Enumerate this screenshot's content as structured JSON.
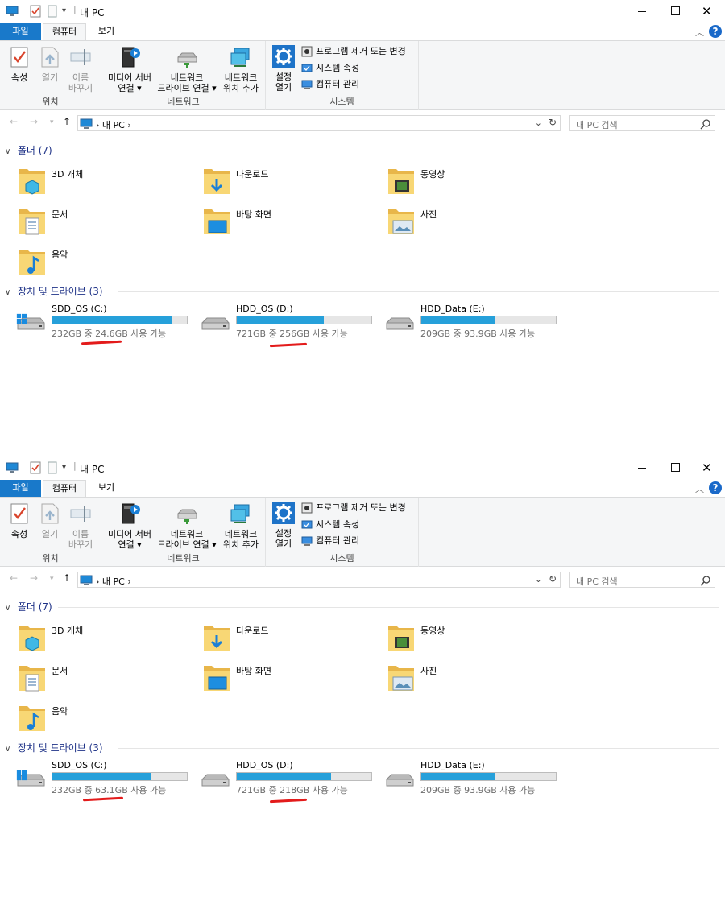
{
  "windows": [
    {
      "title": "내 PC",
      "tabs": [
        "파일",
        "컴퓨터",
        "보기"
      ],
      "ribbon": {
        "groups": [
          "위치",
          "네트워크",
          "시스템"
        ],
        "properties": "속성",
        "open": "열기",
        "rename": [
          "이름",
          "바꾸기"
        ],
        "media_server": [
          "미디어 서버",
          "연결 ▾"
        ],
        "map_drive": [
          "네트워크",
          "드라이브 연결 ▾"
        ],
        "add_location": [
          "네트워크",
          "위치 추가"
        ],
        "settings": [
          "설정",
          "열기"
        ],
        "uninstall": "프로그램 제거 또는 변경",
        "system_props": "시스템 속성",
        "manage": "컴퓨터 관리"
      },
      "address": {
        "path": "›  내 PC  ›",
        "search_placeholder": "내 PC 검색"
      },
      "folders_header": "폴더 (7)",
      "folders": [
        "3D 개체",
        "다운로드",
        "동영상",
        "문서",
        "바탕 화면",
        "사진",
        "음악"
      ],
      "drives_header": "장치 및 드라이브 (3)",
      "drives": [
        {
          "name": "SDD_OS (C:)",
          "free_text": "232GB 중 24.6GB 사용 가능",
          "used_fraction": 0.894
        },
        {
          "name": "HDD_OS (D:)",
          "free_text": "721GB 중 256GB 사용 가능",
          "used_fraction": 0.645
        },
        {
          "name": "HDD_Data (E:)",
          "free_text": "209GB 중 93.9GB 사용 가능",
          "used_fraction": 0.551
        }
      ]
    },
    {
      "title": "내 PC",
      "tabs": [
        "파일",
        "컴퓨터",
        "보기"
      ],
      "ribbon": {
        "groups": [
          "위치",
          "네트워크",
          "시스템"
        ],
        "properties": "속성",
        "open": "열기",
        "rename": [
          "이름",
          "바꾸기"
        ],
        "media_server": [
          "미디어 서버",
          "연결 ▾"
        ],
        "map_drive": [
          "네트워크",
          "드라이브 연결 ▾"
        ],
        "add_location": [
          "네트워크",
          "위치 추가"
        ],
        "settings": [
          "설정",
          "열기"
        ],
        "uninstall": "프로그램 제거 또는 변경",
        "system_props": "시스템 속성",
        "manage": "컴퓨터 관리"
      },
      "address": {
        "path": "›  내 PC  ›",
        "search_placeholder": "내 PC 검색"
      },
      "folders_header": "폴더 (7)",
      "folders": [
        "3D 개체",
        "다운로드",
        "동영상",
        "문서",
        "바탕 화면",
        "사진",
        "음악"
      ],
      "drives_header": "장치 및 드라이브 (3)",
      "drives": [
        {
          "name": "SDD_OS (C:)",
          "free_text": "232GB 중 63.1GB 사용 가능",
          "used_fraction": 0.728
        },
        {
          "name": "HDD_OS (D:)",
          "free_text": "721GB 중 218GB 사용 가능",
          "used_fraction": 0.698
        },
        {
          "name": "HDD_Data (E:)",
          "free_text": "209GB 중 93.9GB 사용 가능",
          "used_fraction": 0.551
        }
      ]
    }
  ],
  "colors": {
    "accent": "#1979ca",
    "drive_bar": "#26a0da",
    "annotation": "#e31b1b"
  }
}
